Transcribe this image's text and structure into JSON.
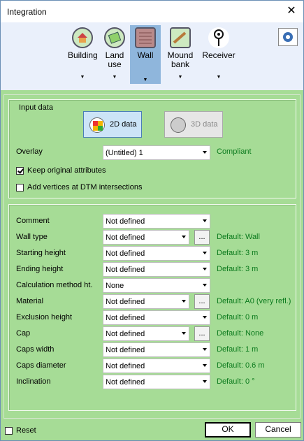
{
  "window": {
    "title": "Integration"
  },
  "toolbar": {
    "buttons": [
      {
        "label": "Building",
        "icon": "building-icon"
      },
      {
        "label": "Land\nuse",
        "icon": "land-use-icon"
      },
      {
        "label": "Wall",
        "icon": "wall-icon",
        "active": true
      },
      {
        "label": "Mound\nbank",
        "icon": "mound-bank-icon"
      },
      {
        "label": "Receiver",
        "icon": "receiver-icon"
      }
    ],
    "dropdown_glyph": "▼"
  },
  "input_data": {
    "title": "Input data",
    "btn_2d": "2D data",
    "btn_3d": "3D data",
    "overlay_label": "Overlay",
    "overlay_value": "(Untitled) 1",
    "overlay_status": "Compliant",
    "keep_attributes": {
      "label": "Keep original attributes",
      "checked": true
    },
    "add_vertices": {
      "label": "Add vertices at DTM intersections",
      "checked": false
    }
  },
  "attributes": {
    "rows": [
      {
        "label": "Comment",
        "value": "Not defined",
        "ellipsis": false,
        "default": ""
      },
      {
        "label": "Wall type",
        "value": "Not defined",
        "ellipsis": true,
        "default": "Default: Wall"
      },
      {
        "label": "Starting height",
        "value": "Not defined",
        "ellipsis": false,
        "default": "Default: 3 m"
      },
      {
        "label": "Ending height",
        "value": "Not defined",
        "ellipsis": false,
        "default": "Default: 3 m"
      },
      {
        "label": "Calculation method ht.",
        "value": "None",
        "ellipsis": false,
        "default": ""
      },
      {
        "label": "Material",
        "value": "Not defined",
        "ellipsis": true,
        "default": "Default: A0 (very refl.)"
      },
      {
        "label": "Exclusion height",
        "value": "Not defined",
        "ellipsis": false,
        "default": "Default: 0 m"
      },
      {
        "label": "Cap",
        "value": "Not defined",
        "ellipsis": true,
        "default": "Default: None"
      },
      {
        "label": "Caps width",
        "value": "Not defined",
        "ellipsis": false,
        "default": "Default: 1 m"
      },
      {
        "label": "Caps diameter",
        "value": "Not defined",
        "ellipsis": false,
        "default": "Default: 0.6 m"
      },
      {
        "label": "Inclination",
        "value": "Not defined",
        "ellipsis": false,
        "default": "Default: 0 °"
      }
    ],
    "ellipsis_label": "..."
  },
  "footer": {
    "reset_label": "Reset",
    "reset_checked": false,
    "ok_label": "OK",
    "cancel_label": "Cancel"
  },
  "colors": {
    "background": "#a6dc96",
    "default_text": "#0b7a1d",
    "active_tool": "#8fb6dc"
  }
}
